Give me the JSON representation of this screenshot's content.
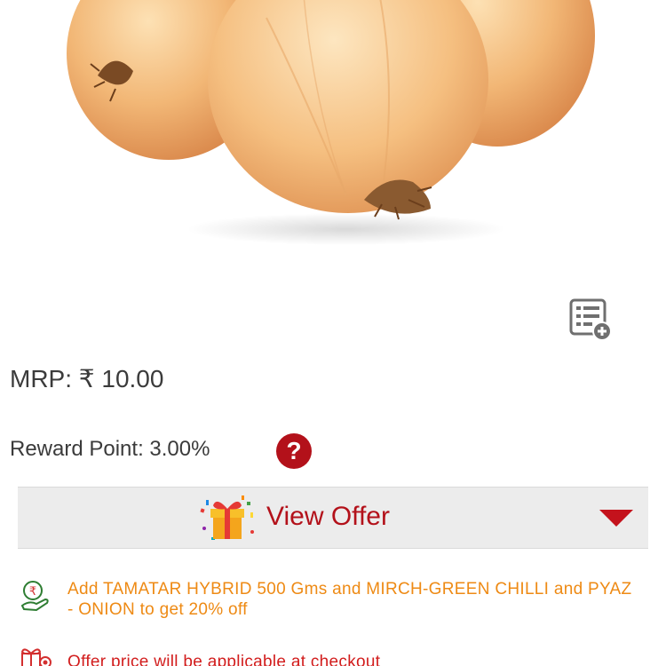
{
  "product": {
    "image_alt": "onion-product-image"
  },
  "price": {
    "mrp_text": "MRP: ₹ 10.00"
  },
  "reward": {
    "text": "Reward Point: 3.00%",
    "help_glyph": "?"
  },
  "offer_bar": {
    "label": "View Offer",
    "icon": "gift-icon",
    "caret_icon": "caret-down-icon"
  },
  "offers": [
    {
      "icon": "rupee-hand-icon",
      "text": "Add TAMATAR HYBRID 500 Gms  and MIRCH-GREEN CHILLI  and PYAZ - ONION  to get 20% off"
    },
    {
      "icon": "gift-box-icon",
      "text": "Offer price will be applicable at checkout"
    }
  ],
  "colors": {
    "brand_red": "#b3111a",
    "offer_orange": "#ee8a14",
    "offer_bar_bg": "#ececec",
    "text_gray": "#3b3b3b"
  }
}
